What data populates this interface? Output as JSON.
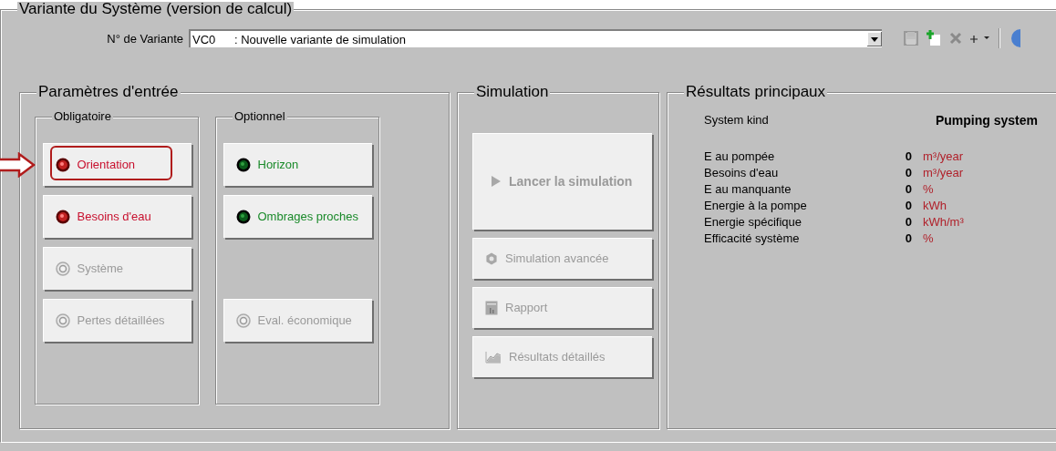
{
  "window": {
    "title": "Variante du Système (version de calcul)"
  },
  "variant": {
    "label": "N° de Variante",
    "code": "VC0",
    "value": ": Nouvelle variante de simulation"
  },
  "input_params": {
    "title": "Paramètres d'entrée",
    "groups": [
      {
        "title": "Obligatoire",
        "buttons": [
          {
            "label": "Orientation",
            "kind": "missing",
            "highlighted": true
          },
          {
            "label": "Besoins d'eau",
            "kind": "missing",
            "highlighted": false
          },
          {
            "label": "Système",
            "kind": "disabled",
            "highlighted": false
          },
          {
            "label": "Pertes détaillées",
            "kind": "disabled",
            "highlighted": false
          }
        ]
      },
      {
        "title": "Optionnel",
        "buttons": [
          {
            "label": "Horizon",
            "kind": "done",
            "highlighted": false
          },
          {
            "label": "Ombrages proches",
            "kind": "done",
            "highlighted": false
          },
          {
            "label": "Eval. économique",
            "kind": "disabled",
            "highlighted": false
          }
        ]
      }
    ]
  },
  "simulation": {
    "title": "Simulation",
    "buttons": [
      {
        "label": "Lancer la simulation",
        "kind": "run",
        "disabled": true
      },
      {
        "label": "Simulation avancée",
        "kind": "gear",
        "disabled": true
      },
      {
        "label": "Rapport",
        "kind": "report",
        "disabled": true
      },
      {
        "label": "Résultats détaillés",
        "kind": "chart",
        "disabled": true
      }
    ]
  },
  "results": {
    "title": "Résultats principaux",
    "system_kind_label": "System kind",
    "system_kind": "Pumping system",
    "rows": [
      {
        "label": "E au pompée",
        "value": "0",
        "unit": "m³/year"
      },
      {
        "label": "Besoins d'eau",
        "value": "0",
        "unit": "m³/year"
      },
      {
        "label": "E au manquante",
        "value": "0",
        "unit": "%"
      },
      {
        "label": "Energie à la pompe",
        "value": "0",
        "unit": "kWh"
      },
      {
        "label": "Energie spécifique",
        "value": "0",
        "unit": "kWh/m³"
      },
      {
        "label": "Efficacité système",
        "value": "0",
        "unit": "%"
      }
    ]
  }
}
